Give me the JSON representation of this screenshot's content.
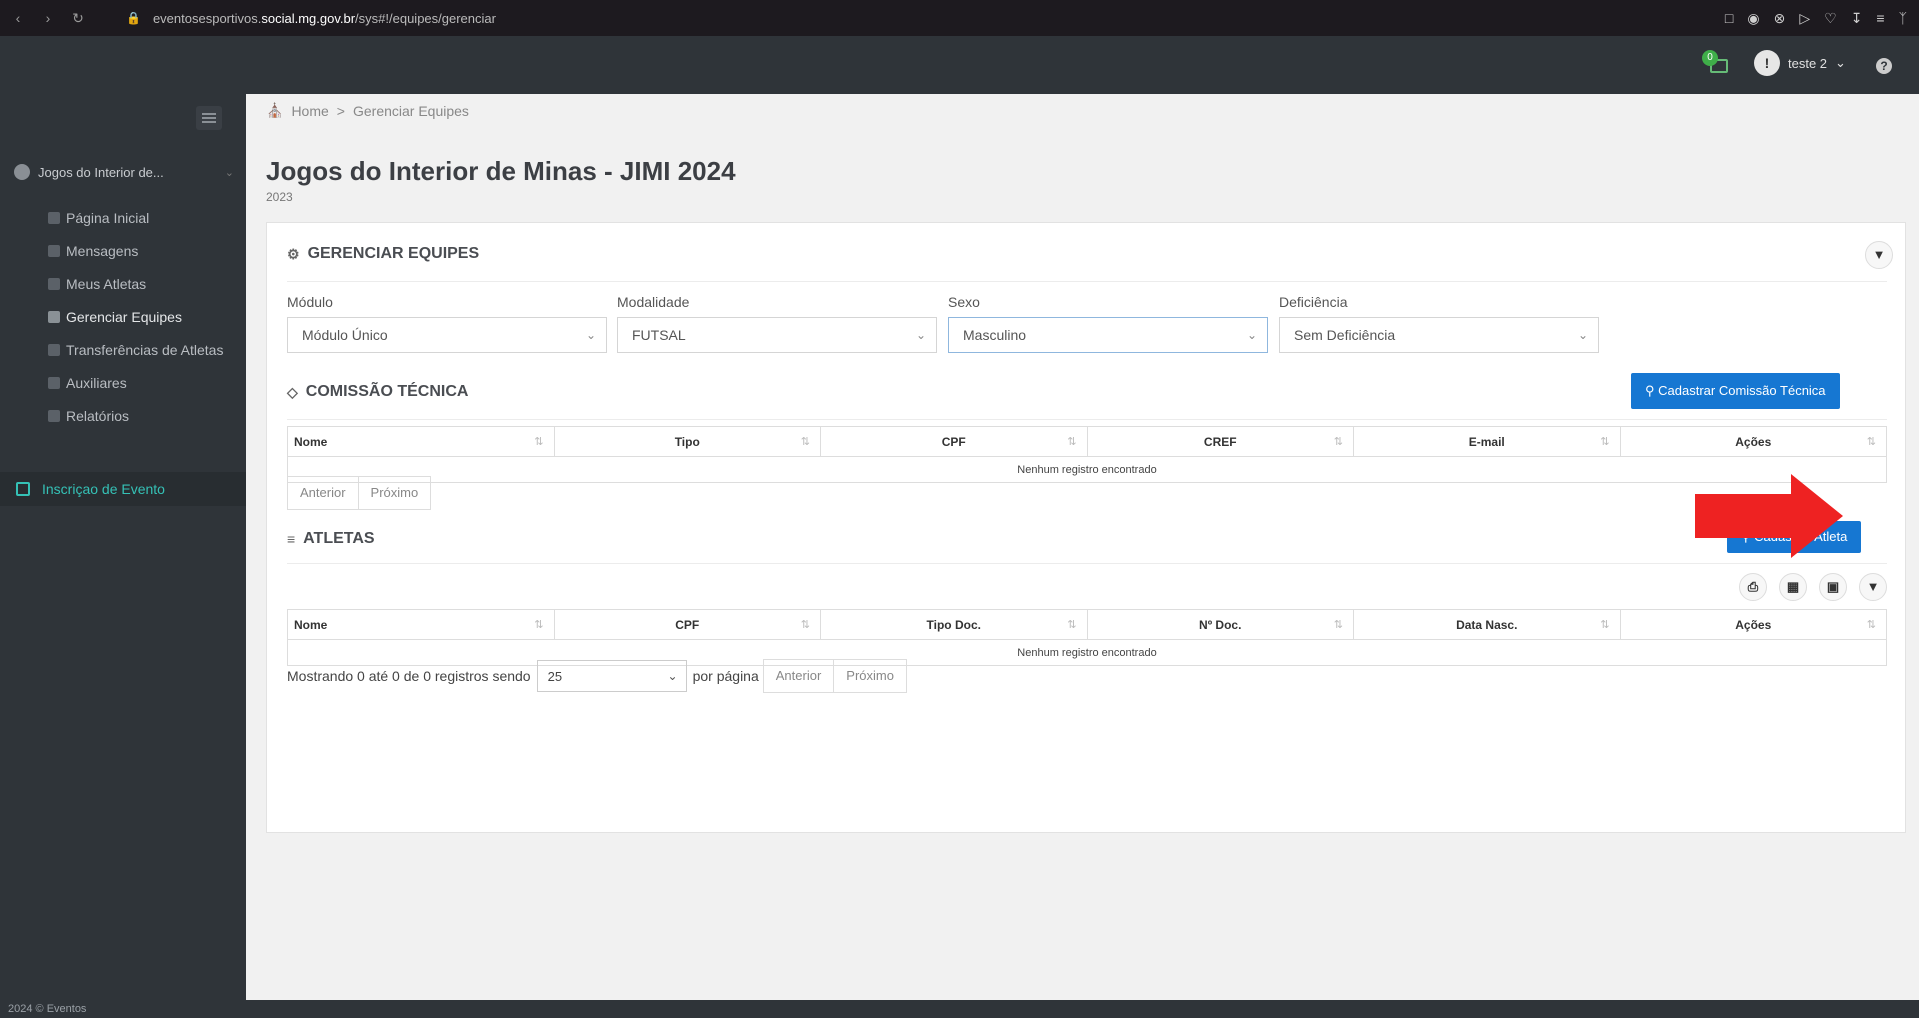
{
  "browser": {
    "url_prefix": "eventosesportivos.",
    "url_domain": "social.mg.gov.br",
    "url_path": "/sys#!/equipes/gerenciar"
  },
  "topbar": {
    "notification_count": "0",
    "user_name": "teste 2"
  },
  "sidebar": {
    "profile_label": "Jogos do Interior de...",
    "items": [
      {
        "label": "Página Inicial"
      },
      {
        "label": "Mensagens"
      },
      {
        "label": "Meus Atletas"
      },
      {
        "label": "Gerenciar Equipes"
      },
      {
        "label": "Transferências de Atletas"
      },
      {
        "label": "Auxiliares"
      },
      {
        "label": "Relatórios"
      }
    ],
    "event_label": "Inscriçao de Evento"
  },
  "breadcrumb": {
    "home": "Home",
    "sep": ">",
    "current": "Gerenciar Equipes"
  },
  "page": {
    "title": "Jogos do Interior de Minas - JIMI 2024",
    "subtitle": "2023"
  },
  "manage": {
    "title": "GERENCIAR EQUIPES",
    "filters": [
      {
        "label": "Módulo",
        "value": "Módulo Único"
      },
      {
        "label": "Modalidade",
        "value": "FUTSAL"
      },
      {
        "label": "Sexo",
        "value": "Masculino"
      },
      {
        "label": "Deficiência",
        "value": "Sem Deficiência"
      }
    ]
  },
  "commission": {
    "title": "COMISSÃO TÉCNICA",
    "button_label": "Cadastrar Comissão Técnica",
    "columns": [
      "Nome",
      "Tipo",
      "CPF",
      "CREF",
      "E-mail",
      "Ações"
    ],
    "empty_text": "Nenhum registro encontrado",
    "prev_label": "Anterior",
    "next_label": "Próximo"
  },
  "athletes": {
    "title": "ATLETAS",
    "button_label": "Cadastrar Atleta",
    "columns": [
      "Nome",
      "CPF",
      "Tipo Doc.",
      "Nº Doc.",
      "Data Nasc.",
      "Ações"
    ],
    "empty_text": "Nenhum registro encontrado",
    "showing_text": "Mostrando 0 até 0 de 0 registros sendo",
    "per_page_value": "25",
    "per_page_suffix": "por página",
    "prev_label": "Anterior",
    "next_label": "Próximo"
  },
  "footer": {
    "text": "2024 © Eventos"
  },
  "colors": {
    "primary_button": "#1677d2",
    "arrow": "#ee2222",
    "sidebar": "#2f3439",
    "event_accent": "#35c1b6"
  }
}
